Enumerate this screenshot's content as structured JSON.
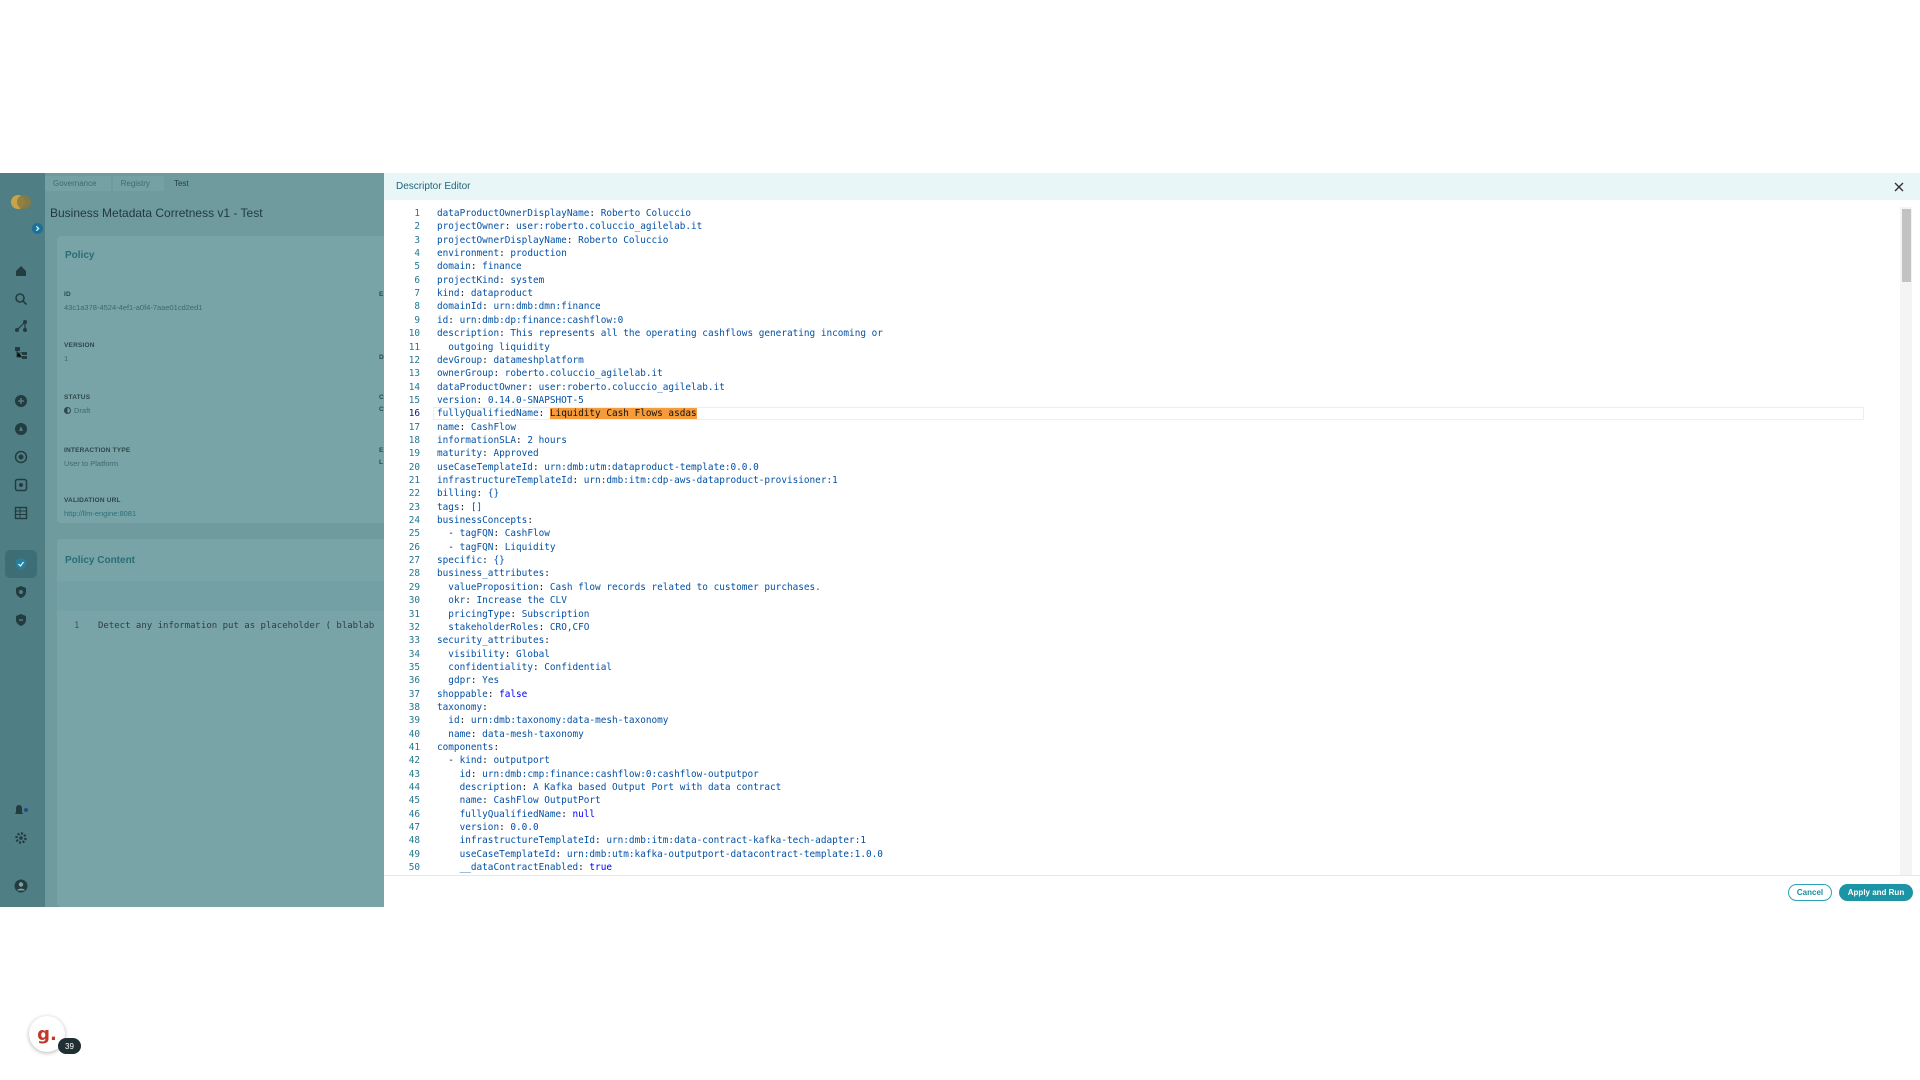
{
  "breadcrumb": [
    "Governance",
    "Registry",
    "Test"
  ],
  "page_title": "Business Metadata Corretness v1 - Test",
  "policy_card": {
    "title": "Policy",
    "fields": [
      {
        "label": "ID",
        "value": "43c1a378-4524-4ef1-a0f4-7aae01cd2ed1"
      },
      {
        "label": "VERSION",
        "value": "1"
      },
      {
        "label": "STATUS",
        "value": "Draft"
      },
      {
        "label": "INTERACTION TYPE",
        "value": "User to Platform"
      },
      {
        "label": "VALIDATION URL",
        "value": "http://llm-engine:8081"
      }
    ],
    "right_column_glimpse": [
      "E",
      "D",
      "C",
      "C",
      "E",
      "L"
    ]
  },
  "policy_content": {
    "title": "Policy Content",
    "line_number": "1",
    "text": "Detect any information put as placeholder ( blablab"
  },
  "notification_count": "39",
  "avatar_letter": "g.",
  "drawer": {
    "title": "Descriptor Editor",
    "cancel_label": "Cancel",
    "apply_label": "Apply and Run",
    "active_line": 16
  },
  "code_lines": [
    [
      "dataProductOwnerDisplayName",
      "Roberto Coluccio",
      ""
    ],
    [
      "projectOwner",
      "user:roberto.coluccio_agilelab.it",
      ""
    ],
    [
      "projectOwnerDisplayName",
      "Roberto Coluccio",
      ""
    ],
    [
      "environment",
      "production",
      ""
    ],
    [
      "domain",
      "finance",
      ""
    ],
    [
      "projectKind",
      "system",
      ""
    ],
    [
      "kind",
      "dataproduct",
      ""
    ],
    [
      "domainId",
      "urn:dmb:dmn:finance",
      ""
    ],
    [
      "id",
      "urn:dmb:dp:finance:cashflow:0",
      ""
    ],
    [
      "description",
      "This represents all the operating cashflows generating incoming or",
      ""
    ],
    [
      "",
      "outgoing liquidity",
      "  "
    ],
    [
      "devGroup",
      "datameshplatform",
      ""
    ],
    [
      "ownerGroup",
      "roberto.coluccio_agilelab.it",
      ""
    ],
    [
      "dataProductOwner",
      "user:roberto.coluccio_agilelab.it",
      ""
    ],
    [
      "version",
      "0.14.0-SNAPSHOT-5",
      ""
    ],
    [
      "fullyQualifiedName",
      "Liquidity Cash Flows asdas",
      "hl"
    ],
    [
      "name",
      "CashFlow",
      ""
    ],
    [
      "informationSLA",
      "2 hours",
      ""
    ],
    [
      "maturity",
      "Approved",
      ""
    ],
    [
      "useCaseTemplateId",
      "urn:dmb:utm:dataproduct-template:0.0.0",
      ""
    ],
    [
      "infrastructureTemplateId",
      "urn:dmb:itm:cdp-aws-dataproduct-provisioner:1",
      ""
    ],
    [
      "billing",
      "{}",
      ""
    ],
    [
      "tags",
      "[]",
      ""
    ],
    [
      "businessConcepts",
      "",
      ""
    ],
    [
      "  - tagFQN",
      "CashFlow",
      ""
    ],
    [
      "  - tagFQN",
      "Liquidity",
      ""
    ],
    [
      "specific",
      "{}",
      ""
    ],
    [
      "business_attributes",
      "",
      ""
    ],
    [
      "  valueProposition",
      "Cash flow records related to customer purchases.",
      ""
    ],
    [
      "  okr",
      "Increase the CLV",
      ""
    ],
    [
      "  pricingType",
      "Subscription",
      ""
    ],
    [
      "  stakeholderRoles",
      "CRO,CFO",
      ""
    ],
    [
      "security_attributes",
      "",
      ""
    ],
    [
      "  visibility",
      "Global",
      ""
    ],
    [
      "  confidentiality",
      "Confidential",
      ""
    ],
    [
      "  gdpr",
      "Yes",
      ""
    ],
    [
      "shoppable",
      "false",
      "kw"
    ],
    [
      "taxonomy",
      "",
      ""
    ],
    [
      "  id",
      "urn:dmb:taxonomy:data-mesh-taxonomy",
      ""
    ],
    [
      "  name",
      "data-mesh-taxonomy",
      ""
    ],
    [
      "components",
      "",
      ""
    ],
    [
      "  - kind",
      "outputport",
      ""
    ],
    [
      "    id",
      "urn:dmb:cmp:finance:cashflow:0:cashflow-outputpor",
      ""
    ],
    [
      "    description",
      "A Kafka based Output Port with data contract",
      ""
    ],
    [
      "    name",
      "CashFlow OutputPort",
      ""
    ],
    [
      "    fullyQualifiedName",
      "null",
      "kw"
    ],
    [
      "    version",
      "0.0.0",
      ""
    ],
    [
      "    infrastructureTemplateId",
      "urn:dmb:itm:data-contract-kafka-tech-adapter:1",
      ""
    ],
    [
      "    useCaseTemplateId",
      "urn:dmb:utm:kafka-outputport-datacontract-template:1.0.0",
      ""
    ],
    [
      "    __dataContractEnabled",
      "true",
      "kw"
    ]
  ],
  "colors": {
    "accent": "#1c94a6",
    "overlay_sidebar": "#4f7f84",
    "overlay_main": "#6f9b9f",
    "header_bg": "#e8f6f8",
    "key_color": "#0451a5",
    "highlight": "#f59b3a"
  },
  "sidebar_icons": [
    "app-logo-icon",
    "expand-icon",
    "home-icon",
    "search-icon",
    "graph-icon",
    "tree-icon",
    "marketplace-icon",
    "compass-icon",
    "target-icon",
    "box-icon",
    "table-icon",
    "shield-check-icon",
    "shield-icon",
    "shield-alt-icon",
    "notification-bell-icon",
    "settings-gear-icon",
    "user-profile-icon"
  ]
}
